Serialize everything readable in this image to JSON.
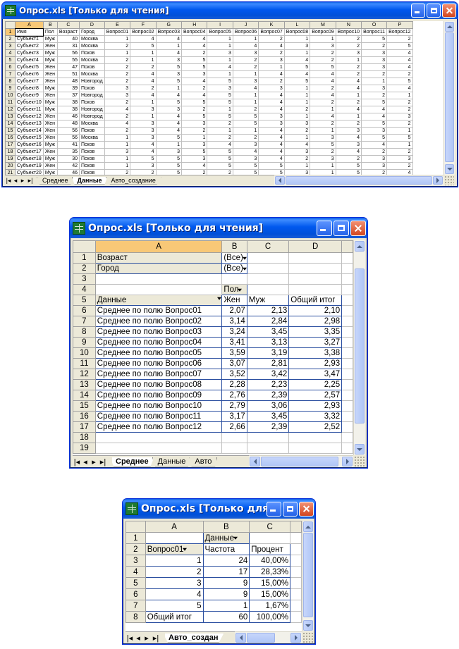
{
  "window1": {
    "title": "Опрос.xls  [Только для чтения]",
    "col_headers": [
      "A",
      "B",
      "C",
      "D",
      "E",
      "F",
      "G",
      "H",
      "I",
      "J",
      "K",
      "L",
      "M",
      "N",
      "O",
      "P"
    ],
    "selected_col": "A",
    "header_row": [
      "Имя",
      "Пол",
      "Возраст",
      "Город",
      "Вопрос01",
      "Вопрос02",
      "Вопрос03",
      "Вопрос04",
      "Вопрос05",
      "Вопрос06",
      "Вопрос07",
      "Вопрос08",
      "Вопрос09",
      "Вопрос10",
      "Вопрос11",
      "Вопрос12"
    ],
    "rows": [
      [
        "Субъект1",
        "Муж",
        "40",
        "Москва",
        "1",
        "4",
        "4",
        "4",
        "1",
        "1",
        "2",
        "1",
        "1",
        "2",
        "5",
        "2"
      ],
      [
        "Субъект2",
        "Жен",
        "31",
        "Москва",
        "2",
        "5",
        "1",
        "4",
        "1",
        "4",
        "4",
        "3",
        "3",
        "2",
        "2",
        "5"
      ],
      [
        "Субъект3",
        "Муж",
        "56",
        "Псков",
        "1",
        "1",
        "4",
        "2",
        "3",
        "3",
        "2",
        "1",
        "2",
        "3",
        "3",
        "4"
      ],
      [
        "Субъект4",
        "Муж",
        "55",
        "Москва",
        "2",
        "1",
        "3",
        "5",
        "1",
        "2",
        "3",
        "4",
        "2",
        "1",
        "3",
        "4"
      ],
      [
        "Субъект5",
        "Жен",
        "47",
        "Псков",
        "2",
        "2",
        "5",
        "5",
        "4",
        "2",
        "1",
        "5",
        "5",
        "2",
        "3",
        "4"
      ],
      [
        "Субъект6",
        "Жен",
        "51",
        "Москва",
        "2",
        "4",
        "3",
        "3",
        "1",
        "1",
        "4",
        "4",
        "4",
        "2",
        "2",
        "2"
      ],
      [
        "Субъект7",
        "Жен",
        "48",
        "Новгород",
        "2",
        "4",
        "5",
        "4",
        "5",
        "3",
        "2",
        "5",
        "4",
        "4",
        "1",
        "5"
      ],
      [
        "Субъект8",
        "Муж",
        "39",
        "Псков",
        "3",
        "2",
        "1",
        "2",
        "3",
        "4",
        "3",
        "1",
        "2",
        "4",
        "3",
        "4"
      ],
      [
        "Субъект9",
        "Жен",
        "37",
        "Новгород",
        "3",
        "4",
        "4",
        "4",
        "5",
        "1",
        "4",
        "1",
        "4",
        "1",
        "2",
        "1"
      ],
      [
        "Субъект10",
        "Муж",
        "38",
        "Псков",
        "2",
        "1",
        "5",
        "5",
        "5",
        "1",
        "4",
        "1",
        "2",
        "2",
        "5",
        "2"
      ],
      [
        "Субъект11",
        "Муж",
        "38",
        "Новгород",
        "4",
        "3",
        "3",
        "2",
        "1",
        "2",
        "4",
        "2",
        "1",
        "4",
        "4",
        "2"
      ],
      [
        "Субъект12",
        "Жен",
        "46",
        "Новгород",
        "2",
        "1",
        "4",
        "5",
        "5",
        "5",
        "3",
        "1",
        "4",
        "1",
        "4",
        "3"
      ],
      [
        "Субъект13",
        "Жен",
        "48",
        "Москва",
        "4",
        "3",
        "4",
        "3",
        "2",
        "5",
        "3",
        "3",
        "2",
        "2",
        "5",
        "2"
      ],
      [
        "Субъект14",
        "Жен",
        "56",
        "Псков",
        "2",
        "3",
        "4",
        "2",
        "1",
        "1",
        "4",
        "2",
        "1",
        "3",
        "3",
        "1"
      ],
      [
        "Субъект15",
        "Жен",
        "56",
        "Москва",
        "1",
        "3",
        "5",
        "1",
        "2",
        "2",
        "4",
        "1",
        "3",
        "4",
        "5",
        "5"
      ],
      [
        "Субъект16",
        "Муж",
        "41",
        "Псков",
        "1",
        "4",
        "1",
        "3",
        "4",
        "3",
        "4",
        "4",
        "5",
        "3",
        "4",
        "1"
      ],
      [
        "Субъект17",
        "Жен",
        "35",
        "Псков",
        "3",
        "4",
        "3",
        "5",
        "5",
        "4",
        "4",
        "3",
        "2",
        "4",
        "2",
        "2"
      ],
      [
        "Субъект18",
        "Муж",
        "30",
        "Псков",
        "1",
        "5",
        "5",
        "3",
        "5",
        "3",
        "4",
        "2",
        "3",
        "2",
        "3",
        "3"
      ],
      [
        "Субъект19",
        "Жен",
        "42",
        "Псков",
        "1",
        "3",
        "5",
        "4",
        "5",
        "5",
        "5",
        "1",
        "1",
        "5",
        "3",
        "2"
      ],
      [
        "Субъект20",
        "Муж",
        "46",
        "Псков",
        "2",
        "2",
        "5",
        "2",
        "2",
        "5",
        "5",
        "3",
        "1",
        "5",
        "2",
        "4"
      ]
    ],
    "row_numbers": [
      "1",
      "2",
      "3",
      "4",
      "5",
      "6",
      "7",
      "8",
      "9",
      "10",
      "11",
      "12",
      "13",
      "14",
      "15",
      "16",
      "17",
      "18",
      "19",
      "20",
      "21"
    ],
    "tabs": [
      "Среднее",
      "Данные",
      "Авто_создание"
    ],
    "active_tab": "Данные"
  },
  "window2": {
    "title": "Опрос.xls  [Только для чтения]",
    "col_headers": [
      "A",
      "B",
      "C",
      "D"
    ],
    "selected_col": "A",
    "row_numbers": [
      "1",
      "2",
      "3",
      "4",
      "5",
      "6",
      "7",
      "8",
      "9",
      "10",
      "11",
      "12",
      "13",
      "14",
      "15",
      "16",
      "17",
      "18",
      "19"
    ],
    "page_fields": [
      {
        "label": "Возраст",
        "value": "(Все)"
      },
      {
        "label": "Город",
        "value": "(Все)"
      }
    ],
    "column_field": "Пол",
    "data_field": "Данные",
    "col_labels": [
      "Жен",
      "Муж",
      "Общий итог"
    ],
    "rows": [
      {
        "label": "Среднее по полю Вопрос01",
        "values": [
          "2,07",
          "2,13",
          "2,10"
        ]
      },
      {
        "label": "Среднее по полю Вопрос02",
        "values": [
          "3,14",
          "2,84",
          "2,98"
        ]
      },
      {
        "label": "Среднее по полю Вопрос03",
        "values": [
          "3,24",
          "3,45",
          "3,35"
        ]
      },
      {
        "label": "Среднее по полю Вопрос04",
        "values": [
          "3,41",
          "3,13",
          "3,27"
        ]
      },
      {
        "label": "Среднее по полю Вопрос05",
        "values": [
          "3,59",
          "3,19",
          "3,38"
        ]
      },
      {
        "label": "Среднее по полю Вопрос06",
        "values": [
          "3,07",
          "2,81",
          "2,93"
        ]
      },
      {
        "label": "Среднее по полю Вопрос07",
        "values": [
          "3,52",
          "3,42",
          "3,47"
        ]
      },
      {
        "label": "Среднее по полю Вопрос08",
        "values": [
          "2,28",
          "2,23",
          "2,25"
        ]
      },
      {
        "label": "Среднее по полю Вопрос09",
        "values": [
          "2,76",
          "2,39",
          "2,57"
        ]
      },
      {
        "label": "Среднее по полю Вопрос10",
        "values": [
          "2,79",
          "3,06",
          "2,93"
        ]
      },
      {
        "label": "Среднее по полю Вопрос11",
        "values": [
          "3,17",
          "3,45",
          "3,32"
        ]
      },
      {
        "label": "Среднее по полю Вопрос12",
        "values": [
          "2,66",
          "2,39",
          "2,52"
        ]
      }
    ],
    "tabs": [
      "Среднее",
      "Данные",
      "Авто"
    ],
    "active_tab": "Среднее"
  },
  "window3": {
    "title": "Опрос.xls  [Только для чт...",
    "col_headers": [
      "A",
      "B",
      "C"
    ],
    "row_numbers": [
      "1",
      "2",
      "3",
      "4",
      "5",
      "6",
      "7",
      "8"
    ],
    "data_field": "Данные",
    "row_field": "Вопрос01",
    "col_labels": [
      "Частота",
      "Процент"
    ],
    "rows": [
      {
        "label": "1",
        "values": [
          "24",
          "40,00%"
        ]
      },
      {
        "label": "2",
        "values": [
          "17",
          "28,33%"
        ]
      },
      {
        "label": "3",
        "values": [
          "9",
          "15,00%"
        ]
      },
      {
        "label": "4",
        "values": [
          "9",
          "15,00%"
        ]
      },
      {
        "label": "5",
        "values": [
          "1",
          "1,67%"
        ]
      }
    ],
    "total": {
      "label": "Общий итог",
      "values": [
        "60",
        "100,00%"
      ]
    },
    "tabs": [
      "Авто_создан"
    ],
    "active_tab": "Авто_создан"
  },
  "colors": {
    "titlebar": "#0058ee",
    "sheet_header": "#ece9d8",
    "selected_header": "#f8c877",
    "pivot_border": "#2b4fa0"
  }
}
